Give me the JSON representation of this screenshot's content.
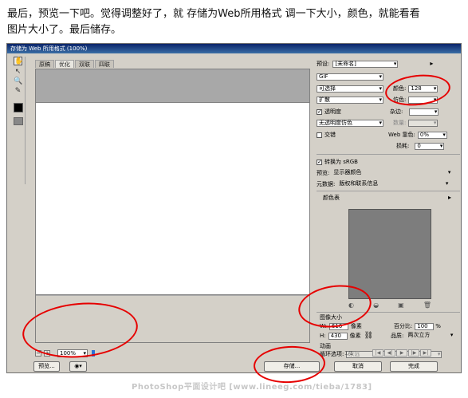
{
  "caption": {
    "line1": "最后，预览一下吧。觉得调整好了，就 存储为Web所用格式 调一下大小，颜色，就能看看",
    "line2": "图片大小了。最后储存。"
  },
  "window": {
    "title": "存储为 Web 所用格式 (100%)"
  },
  "tabs": [
    "原稿",
    "优化",
    "双联",
    "四联"
  ],
  "status": {
    "zoom": "100%"
  },
  "panel": {
    "preset_label": "预设:",
    "preset_value": "[未命名]",
    "format": "GIF",
    "reduction": "可选择",
    "colors_label": "颜色:",
    "colors_value": "128",
    "dither_method": "扩散",
    "dither_label": "仿色:",
    "transparency_label": "透明度",
    "matte_label": "杂边:",
    "transparency_dither": "无透明度仿色",
    "amount_label": "数量:",
    "interlaced_label": "交错",
    "web_snap_label": "Web 靠色:",
    "web_snap_value": "0%",
    "lossy_label": "损耗:",
    "lossy_value": "0",
    "srgb_label": "转换为 sRGB",
    "preview_label": "预览:",
    "preview_value": "显示器颜色",
    "metadata_label": "元数据:",
    "metadata_value": "版权和联系信息",
    "color_table_label": "颜色表",
    "image_size_label": "图像大小",
    "width_label": "W:",
    "width_value": "616",
    "height_label": "H:",
    "height_value": "430",
    "unit_w": "像素",
    "unit_h": "像素",
    "percent_label": "百分比:",
    "percent_value": "100",
    "percent_unit": "%",
    "quality_label": "品质:",
    "quality_value": "两次立方",
    "animation_label": "动画",
    "loop_label": "循环选项:",
    "loop_value": "永远",
    "frame_counter": "1/1"
  },
  "buttons": {
    "preview": "预览...",
    "save": "存储...",
    "cancel": "取消",
    "done": "完成"
  },
  "watermark": "PhotoShop平面设计吧 [www.lineeg.com/tieba/1783]",
  "colors": {
    "annotation": "#e60000",
    "window_bg": "#d4d0c8",
    "color_table": "#7d7d7d"
  }
}
